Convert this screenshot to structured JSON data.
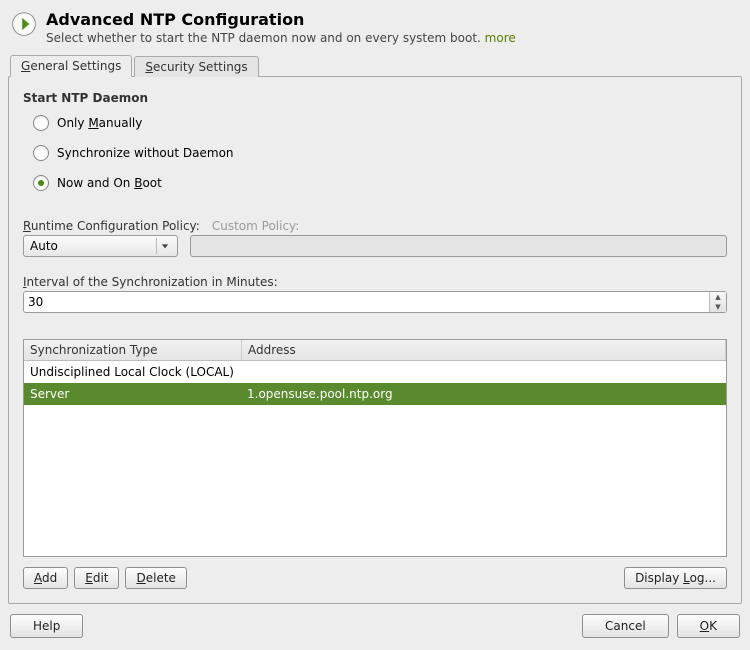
{
  "header": {
    "title": "Advanced NTP Configuration",
    "subtitle_prefix": "Select whether to start the NTP daemon now and on every system boot. ",
    "more_label": "more"
  },
  "tabs": {
    "general": {
      "prefix": "",
      "mn": "G",
      "rest": "eneral Settings"
    },
    "security": {
      "prefix": "",
      "mn": "S",
      "rest": "ecurity Settings"
    },
    "active": "general"
  },
  "daemon_group": {
    "title": "Start NTP Daemon",
    "radios": [
      {
        "prefix": "Only ",
        "mn": "M",
        "rest": "anually",
        "value": "manual"
      },
      {
        "prefix": "Synchronize without Daemon",
        "mn": "",
        "rest": "",
        "value": "nodaemon"
      },
      {
        "prefix": "Now and On ",
        "mn": "B",
        "rest": "oot",
        "value": "boot"
      }
    ],
    "selected": "boot"
  },
  "runtime_policy": {
    "label_prefix": "",
    "label_mn": "R",
    "label_rest": "untime Configuration Policy:",
    "options": [
      "Auto"
    ],
    "value": "Auto",
    "custom_label": "Custom Policy:",
    "custom_value": ""
  },
  "interval": {
    "label_prefix": "",
    "label_mn": "I",
    "label_rest": "nterval of the Synchronization in Minutes:",
    "value": "30"
  },
  "table": {
    "headers": {
      "col1": "Synchronization Type",
      "col2": "Address"
    },
    "rows": [
      {
        "type": "Undisciplined Local Clock (LOCAL)",
        "address": ""
      },
      {
        "type": "Server",
        "address": "1.opensuse.pool.ntp.org"
      }
    ],
    "selected_index": 1
  },
  "buttons": {
    "add_mn": "A",
    "add_rest": "dd",
    "edit_mn": "E",
    "edit_rest": "dit",
    "delete_mn": "D",
    "delete_rest": "elete",
    "display_log_prefix": "Display ",
    "display_log_mn": "L",
    "display_log_rest": "og...",
    "help": "Help",
    "cancel": "Cancel",
    "ok_mn": "O",
    "ok_rest": "K"
  }
}
